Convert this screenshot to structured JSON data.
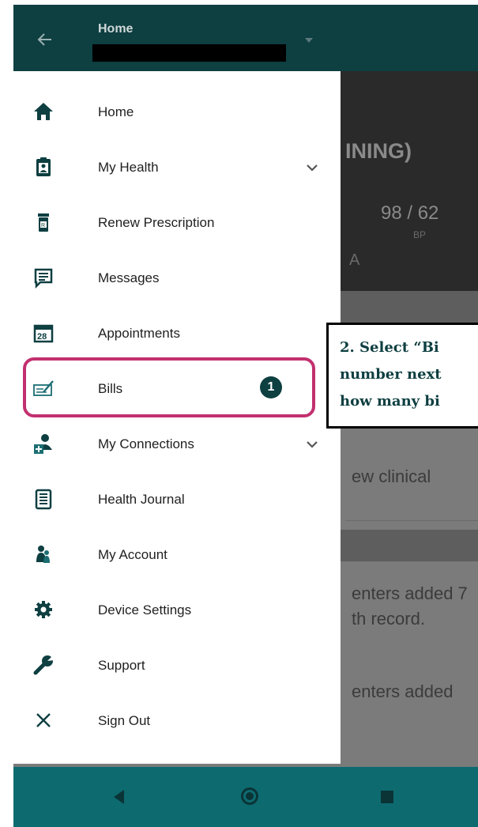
{
  "app_bar": {
    "title": "Home"
  },
  "drawer": {
    "items": [
      {
        "label": "Home",
        "icon": "home-icon",
        "chevron": false
      },
      {
        "label": "My Health",
        "icon": "clipboard-person-icon",
        "chevron": true
      },
      {
        "label": "Renew Prescription",
        "icon": "prescription-bottle-icon",
        "chevron": false
      },
      {
        "label": "Messages",
        "icon": "message-icon",
        "chevron": false
      },
      {
        "label": "Appointments",
        "icon": "calendar-icon",
        "calendar_day": "28",
        "chevron": false
      },
      {
        "label": "Bills",
        "icon": "bill-check-icon",
        "badge": "1",
        "chevron": false
      },
      {
        "label": "My Connections",
        "icon": "connections-icon",
        "chevron": true
      },
      {
        "label": "Health Journal",
        "icon": "journal-icon",
        "chevron": false
      },
      {
        "label": "My Account",
        "icon": "account-icon",
        "chevron": false
      },
      {
        "label": "Device Settings",
        "icon": "gear-icon",
        "chevron": false
      },
      {
        "label": "Support",
        "icon": "wrench-icon",
        "chevron": false
      },
      {
        "label": "Sign Out",
        "icon": "close-icon",
        "chevron": false
      }
    ]
  },
  "background": {
    "heading_fragment": "INING)",
    "bp_value": "98 / 62",
    "bp_label": "BP",
    "fragment_a": "A",
    "clinical_fragment": "ew clinical",
    "centers_fragment_1": "enters added 7",
    "record_fragment": "th record.",
    "centers_fragment_2": "enters added"
  },
  "callout": {
    "lines": [
      "2.  Select “Bi",
      "number next",
      "how many bi"
    ]
  },
  "colors": {
    "teal_dark": "#0e3f41",
    "teal_nav": "#0d6b70",
    "highlight": "#c2306f"
  }
}
